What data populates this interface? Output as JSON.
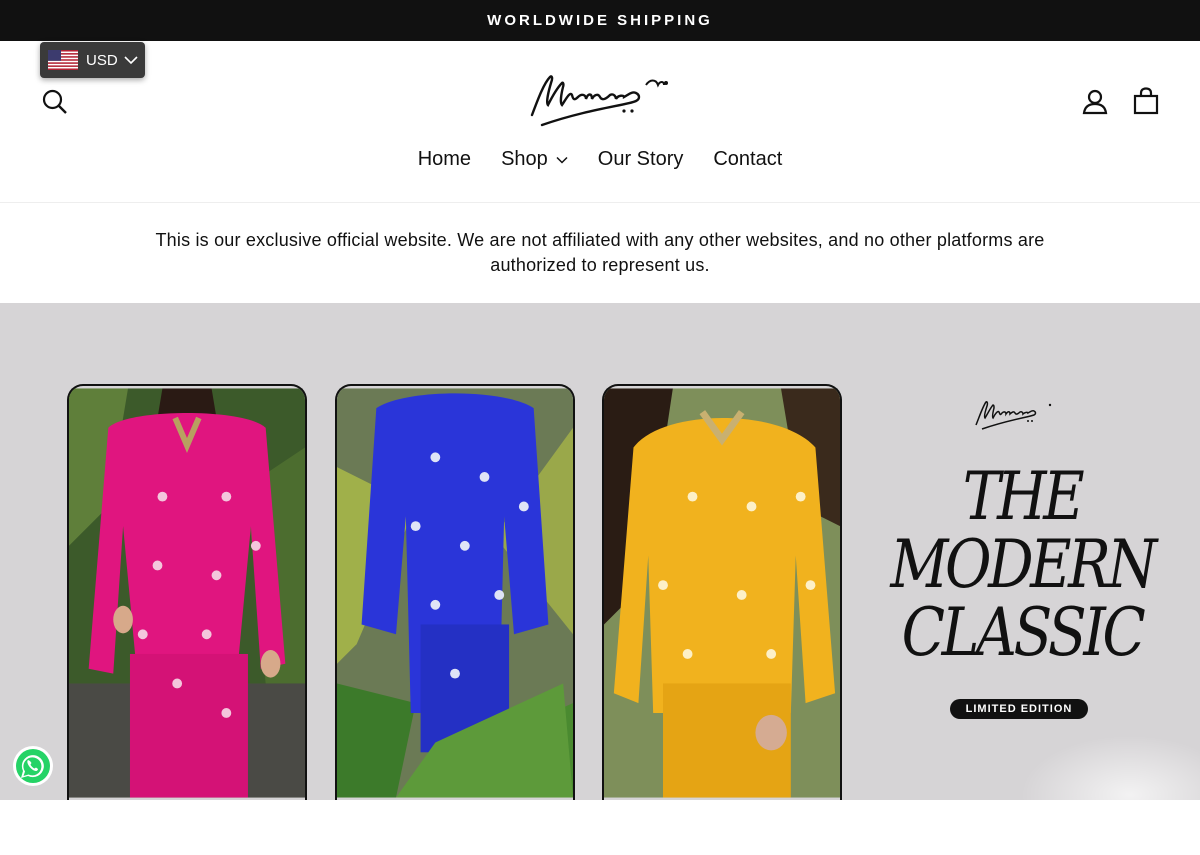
{
  "announcement": "WORLDWIDE SHIPPING",
  "currency": {
    "code": "USD"
  },
  "nav": {
    "items": [
      {
        "label": "Home"
      },
      {
        "label": "Shop"
      },
      {
        "label": "Our Story"
      },
      {
        "label": "Contact"
      }
    ]
  },
  "notice": "This is our exclusive official website. We are not affiliated with any other websites, and no other platforms are authorized to represent us.",
  "hero": {
    "headline": [
      "THE",
      "MODERN",
      "CLASSIC"
    ],
    "badge": "LIMITED EDITION",
    "products": [
      {
        "color": "#e0157f",
        "name": "pink"
      },
      {
        "color": "#2a35d9",
        "name": "blue"
      },
      {
        "color": "#f1b21e",
        "name": "yellow"
      }
    ]
  },
  "colors": {
    "announce_bg": "#111111",
    "hero_bg": "#d6d4d6",
    "whatsapp": "#25d366"
  },
  "icons": [
    "search-icon",
    "account-icon",
    "cart-icon",
    "chevron-down-icon",
    "whatsapp-icon",
    "us-flag-icon"
  ]
}
